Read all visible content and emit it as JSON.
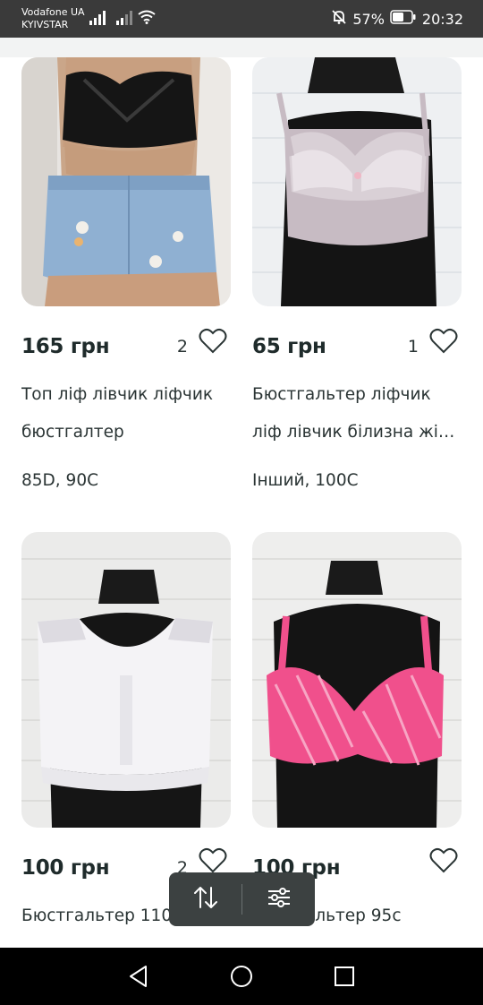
{
  "status_bar": {
    "carrier_line1": "Vodafone UA",
    "carrier_line2": "KYIVSTAR",
    "battery": "57%",
    "time": "20:32",
    "icons": [
      "signal-icon",
      "signal-icon",
      "wifi-icon",
      "mute-bell-icon",
      "battery-icon"
    ]
  },
  "listings": [
    {
      "price": "165 грн",
      "likes": "2",
      "title_line1": "Топ ліф лівчик ліфчик",
      "title_line2": "бюстгалтер",
      "size": "85D, 90C"
    },
    {
      "price": "65 грн",
      "likes": "1",
      "title_line1": "Бюстгальтер ліфчик",
      "title_line2": "ліф лівчик білизна жін…",
      "size": "Інший, 100C"
    },
    {
      "price": "100 грн",
      "likes": "2",
      "title_line1": "Бюстгальтер 110",
      "title_line2": "",
      "size": ""
    },
    {
      "price": "100 грн",
      "likes": "",
      "title_line1": "Бюстгальтер 95с",
      "title_line2": "",
      "size": ""
    }
  ],
  "controls": {
    "sort_icon": "sort-arrows-icon",
    "filter_icon": "filter-sliders-icon"
  },
  "nav": {
    "icons": [
      "back-icon",
      "home-icon",
      "recents-icon"
    ]
  },
  "colors": {
    "accent": "#1f2b2b",
    "overlay": "#3c4141",
    "status_bar": "#3a3a3a",
    "pink_bra": "#f0508c"
  }
}
